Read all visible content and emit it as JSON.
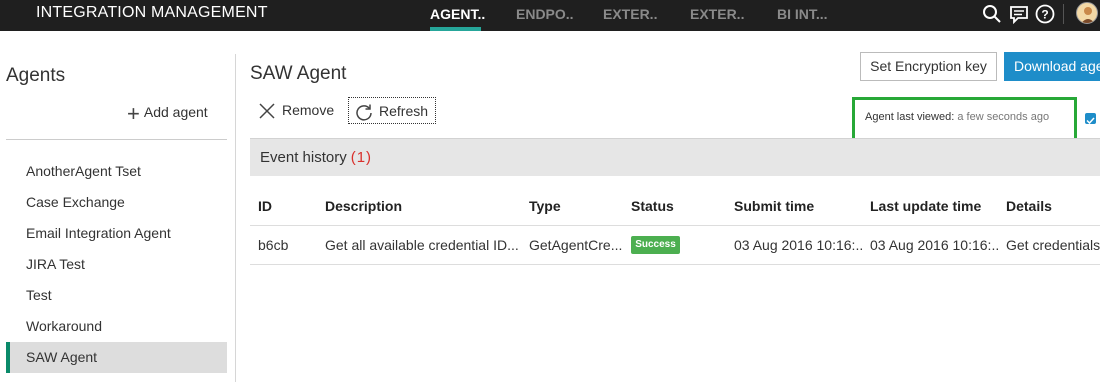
{
  "header": {
    "title": "INTEGRATION MANAGEMENT",
    "tabs": [
      {
        "label": "AGENT..",
        "active": true
      },
      {
        "label": "ENDPO..",
        "active": false
      },
      {
        "label": "EXTER..",
        "active": false
      },
      {
        "label": "EXTER..",
        "active": false
      },
      {
        "label": "BI INT...",
        "active": false
      }
    ],
    "icons": [
      "search-icon",
      "chat-icon",
      "help-icon",
      "user-avatar"
    ],
    "accent_color": "#26a69a"
  },
  "sidebar": {
    "title": "Agents",
    "add_label": "Add agent",
    "items": [
      {
        "label": "AnotherAgent Tset"
      },
      {
        "label": "Case Exchange"
      },
      {
        "label": "Email Integration Agent"
      },
      {
        "label": "JIRA Test"
      },
      {
        "label": "Test"
      },
      {
        "label": "Workaround"
      },
      {
        "label": "SAW Agent",
        "selected": true
      }
    ]
  },
  "main": {
    "title": "SAW Agent",
    "set_key_label": "Set Encryption key",
    "download_label": "Download age",
    "remove_label": "Remove",
    "refresh_label": "Refresh",
    "last_viewed_label": "Agent last viewed:",
    "last_viewed_value": "a few seconds ago",
    "event_history_label": "Event history",
    "event_count": "(1)",
    "columns": [
      "ID",
      "Description",
      "Type",
      "Status",
      "Submit time",
      "Last update time",
      "Details"
    ],
    "rows": [
      {
        "id": "b6cb",
        "description": "Get all available credential ID...",
        "type": "GetAgentCre...",
        "status": "Success",
        "submit_time": "03 Aug 2016 10:16:...",
        "last_update": "03 Aug 2016 10:16:...",
        "details": "Get credentials"
      }
    ],
    "status_color": "#4caf50",
    "highlight_color": "#27a837"
  }
}
